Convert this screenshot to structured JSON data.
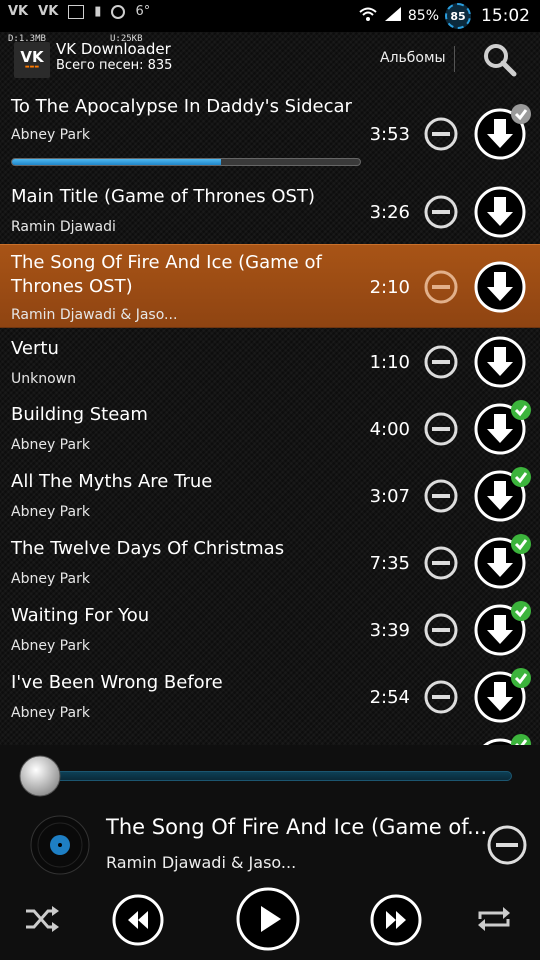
{
  "status_bar": {
    "temperature": "6°",
    "battery_percent": "85%",
    "badge_value": "85",
    "time": "15:02",
    "download_traffic": "D:1.3MB",
    "upload_traffic": "U:25KB"
  },
  "header": {
    "title": "VK Downloader",
    "subtitle": "Всего песен: 835",
    "albums_label": "Альбомы"
  },
  "tracks": [
    {
      "title": "To The Apocalypse In Daddy's Sidecar",
      "artist": "Abney Park",
      "duration": "3:53",
      "downloaded": true,
      "progress": 0.6
    },
    {
      "title": "Main Title (Game of Thrones OST)",
      "artist": "Ramin Djawadi",
      "duration": "3:26",
      "downloaded": false
    },
    {
      "title": "The Song Of Fire And Ice (Game of Thrones OST)",
      "artist": "Ramin Djawadi & Jaso...",
      "duration": "2:10",
      "downloaded": false,
      "playing": true
    },
    {
      "title": "Vertu",
      "artist": "Unknown",
      "duration": "1:10",
      "downloaded": false
    },
    {
      "title": "Building Steam",
      "artist": "Abney Park",
      "duration": "4:00",
      "downloaded": true
    },
    {
      "title": "All The Myths Are True",
      "artist": "Abney Park",
      "duration": "3:07",
      "downloaded": true
    },
    {
      "title": "The Twelve Days Of Christmas",
      "artist": "Abney Park",
      "duration": "7:35",
      "downloaded": true
    },
    {
      "title": "Waiting For You",
      "artist": "Abney Park",
      "duration": "3:39",
      "downloaded": true
    },
    {
      "title": "I've Been Wrong Before",
      "artist": "Abney Park",
      "duration": "2:54",
      "downloaded": true
    }
  ],
  "player": {
    "title": "The Song Of Fire And Ice (Game of...",
    "artist": "Ramin Djawadi & Jaso...",
    "seek_fraction": 0.0
  },
  "colors": {
    "accent": "#1f86c9",
    "active_row": "#9a4a14",
    "check": "#3cb43c"
  },
  "icons": [
    "vk-icon",
    "image-icon",
    "wifi-icon",
    "signal-icon",
    "search-icon",
    "minus-circle-icon",
    "download-arrow-icon",
    "check-icon",
    "shuffle-icon",
    "rewind-icon",
    "play-icon",
    "fast-forward-icon",
    "repeat-icon"
  ]
}
